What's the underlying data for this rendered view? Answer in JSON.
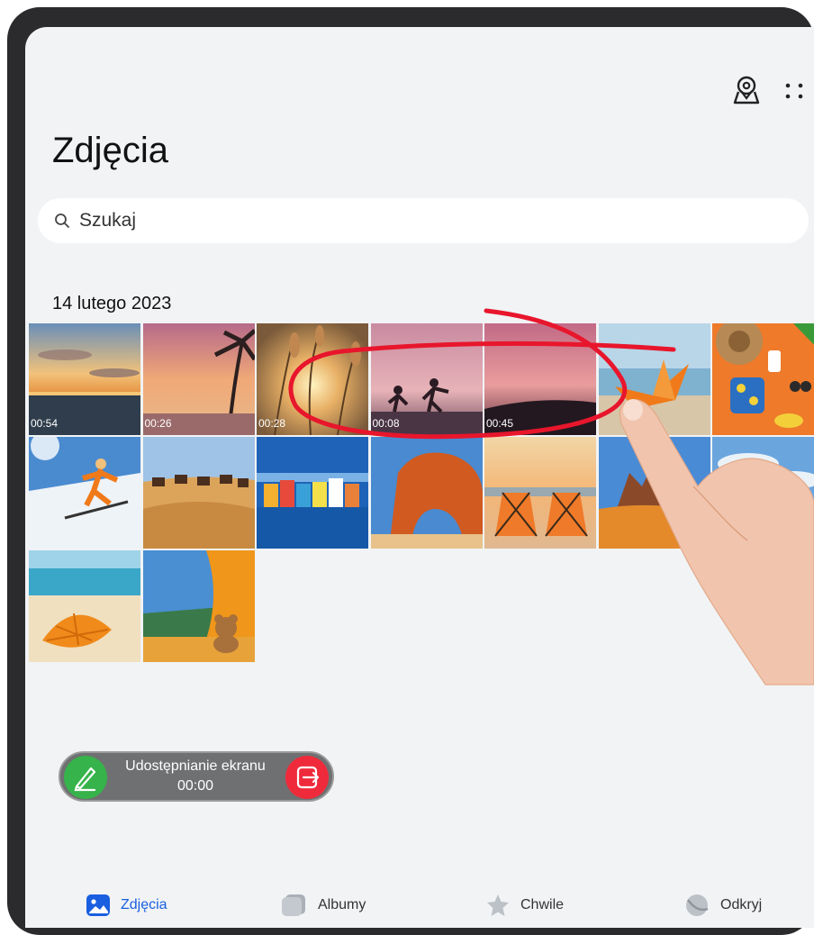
{
  "header": {
    "title": "Zdjęcia"
  },
  "search": {
    "placeholder": "Szukaj"
  },
  "gallery": {
    "date": "14 lutego 2023",
    "rows": [
      [
        {
          "theme": "sunset-sea",
          "duration": "00:54"
        },
        {
          "theme": "palm-sunset",
          "duration": "00:26"
        },
        {
          "theme": "reeds-sunset",
          "duration": "00:28"
        },
        {
          "theme": "beach-dancers",
          "duration": "00:08"
        },
        {
          "theme": "pink-sea",
          "duration": "00:45"
        },
        {
          "theme": "paper-boat"
        },
        {
          "theme": "beach-items"
        }
      ],
      [
        {
          "theme": "skier"
        },
        {
          "theme": "camel-caravan"
        },
        {
          "theme": "colorful-houses"
        },
        {
          "theme": "rock-arch"
        },
        {
          "theme": "beach-chairs"
        },
        {
          "theme": "desert-rocks"
        },
        {
          "theme": "sky-clouds"
        }
      ],
      [
        {
          "theme": "orange-umbrella"
        },
        {
          "theme": "tent-teddy"
        }
      ]
    ]
  },
  "screen_share": {
    "label": "Udostępnianie ekranu",
    "timer": "00:00"
  },
  "bottom_nav": {
    "items": [
      {
        "label": "Zdjęcia",
        "icon": "photos-icon",
        "active": true
      },
      {
        "label": "Albumy",
        "icon": "albums-icon",
        "active": false
      },
      {
        "label": "Chwile",
        "icon": "moments-star-icon",
        "active": false
      },
      {
        "label": "Odkryj",
        "icon": "discover-icon",
        "active": false
      }
    ]
  },
  "colors": {
    "accent": "#1a5fe0",
    "annotation": "#e8162c",
    "share_green": "#36b34a",
    "share_red": "#ef2b3b"
  }
}
